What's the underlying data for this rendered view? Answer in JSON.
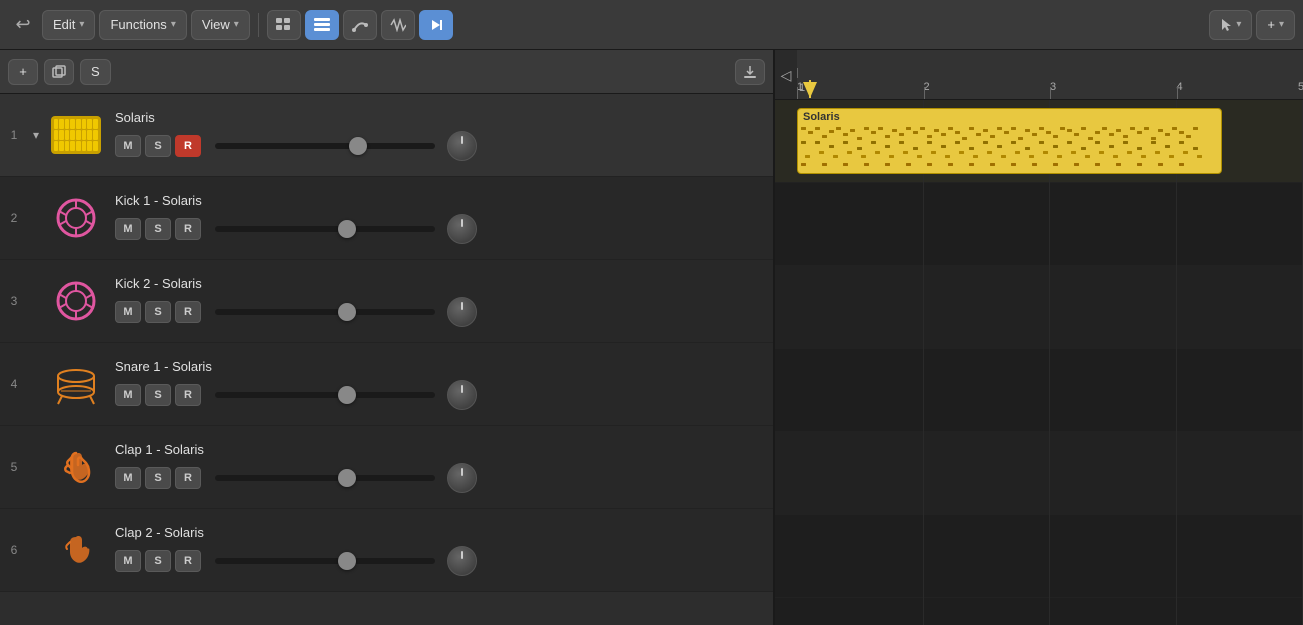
{
  "toolbar": {
    "back_label": "↩",
    "edit_label": "Edit",
    "edit_chevron": "▾",
    "functions_label": "Functions",
    "functions_chevron": "▾",
    "view_label": "View",
    "view_chevron": "▾",
    "grid_icon": "grid",
    "list_icon": "list",
    "curve_icon": "curve",
    "wave_icon": "wave",
    "snap_icon": "snap",
    "cursor_icon": "cursor",
    "cursor_chevron": "▾",
    "add_icon": "+",
    "add_chevron": "▾"
  },
  "secondary_toolbar": {
    "add_btn": "+",
    "duplicate_btn": "⊕",
    "s_btn": "S",
    "download_icon": "⬇"
  },
  "tracks": [
    {
      "number": "1",
      "name": "Solaris",
      "has_expand": true,
      "icon_type": "drum_machine",
      "mute": "M",
      "solo": "S",
      "record": "R",
      "record_active": true,
      "volume_pos": 0.65,
      "is_main": true
    },
    {
      "number": "2",
      "name": "Kick 1 - Solaris",
      "has_expand": false,
      "icon_type": "kick",
      "mute": "M",
      "solo": "S",
      "record": "R",
      "record_active": false,
      "volume_pos": 0.6
    },
    {
      "number": "3",
      "name": "Kick 2 - Solaris",
      "has_expand": false,
      "icon_type": "kick2",
      "mute": "M",
      "solo": "S",
      "record": "R",
      "record_active": false,
      "volume_pos": 0.6
    },
    {
      "number": "4",
      "name": "Snare 1 - Solaris",
      "has_expand": false,
      "icon_type": "snare",
      "mute": "M",
      "solo": "S",
      "record": "R",
      "record_active": false,
      "volume_pos": 0.6
    },
    {
      "number": "5",
      "name": "Clap 1 - Solaris",
      "has_expand": false,
      "icon_type": "clap",
      "mute": "M",
      "solo": "S",
      "record": "R",
      "record_active": false,
      "volume_pos": 0.6
    },
    {
      "number": "6",
      "name": "Clap 2 - Solaris",
      "has_expand": false,
      "icon_type": "clap2",
      "mute": "M",
      "solo": "S",
      "record": "R",
      "record_active": false,
      "volume_pos": 0.6
    }
  ],
  "timeline": {
    "ruler_marks": [
      "1",
      "2",
      "3",
      "4",
      "5"
    ],
    "region_name": "Solaris"
  }
}
